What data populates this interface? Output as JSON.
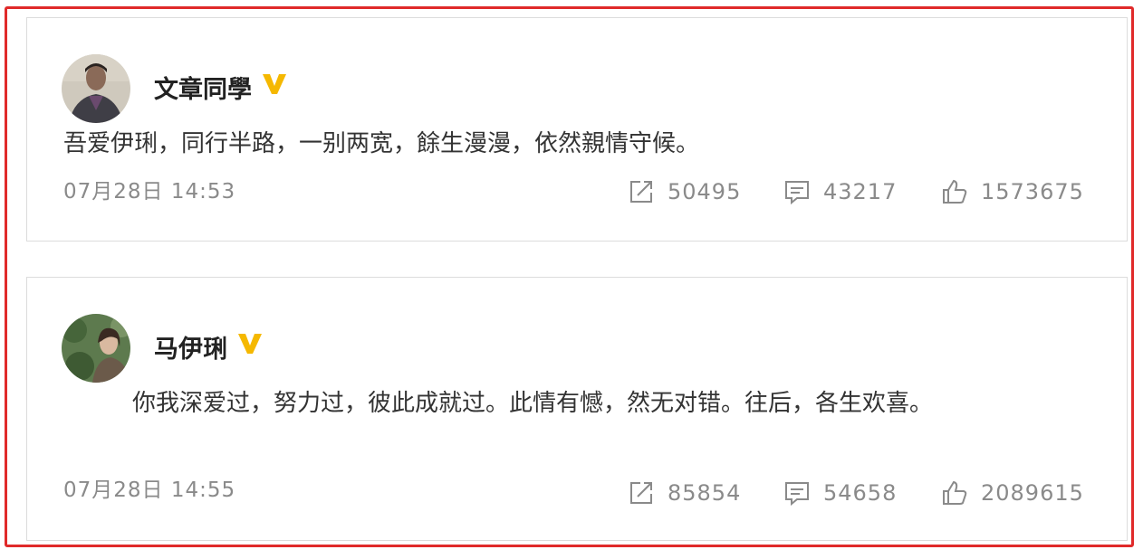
{
  "posts": [
    {
      "user": "文章同學",
      "content": "吾爱伊琍，同行半路，一别两宽，餘生漫漫，依然親情守候。",
      "time": "07月28日 14:53",
      "reposts": "50495",
      "comments": "43217",
      "likes": "1573675",
      "icons": {
        "badge": "verified-v-icon",
        "repost": "share-icon",
        "comment": "comment-icon",
        "like": "thumbs-up-icon"
      }
    },
    {
      "user": "马伊琍",
      "content": "你我深爱过，努力过，彼此成就过。此情有憾，然无对错。往后，各生欢喜。",
      "time": "07月28日 14:55",
      "reposts": "85854",
      "comments": "54658",
      "likes": "2089615",
      "icons": {
        "badge": "verified-v-icon",
        "repost": "share-icon",
        "comment": "comment-icon",
        "like": "thumbs-up-icon"
      }
    }
  ],
  "colors": {
    "frame": "#e02a2a",
    "badge": "#f5b800",
    "meta": "#8a8a8a",
    "text": "#333333"
  }
}
